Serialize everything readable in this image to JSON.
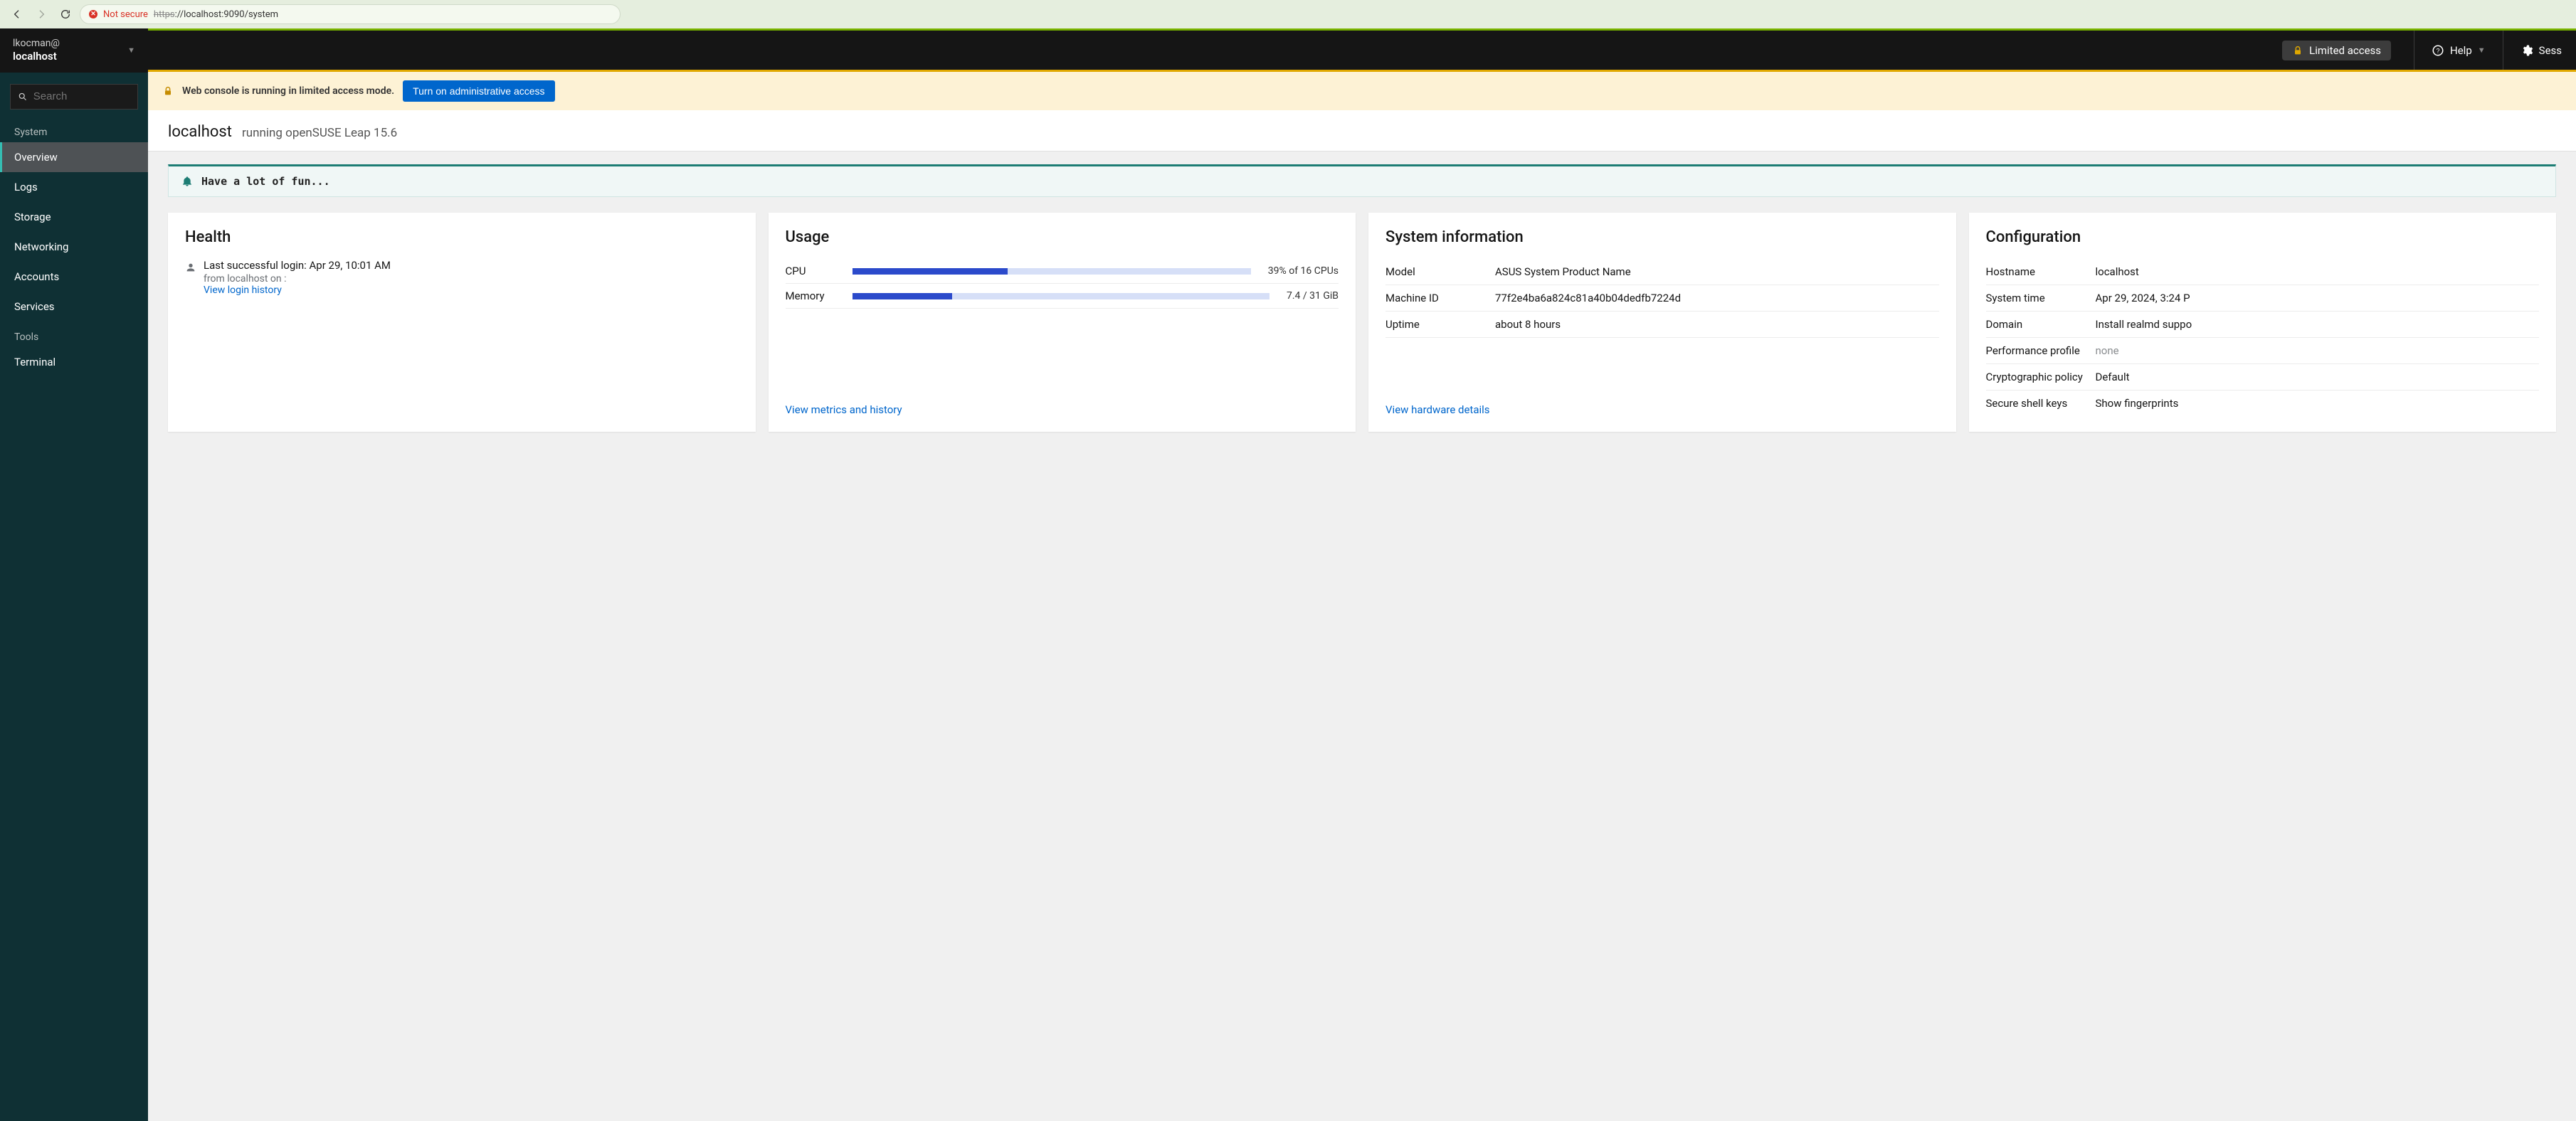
{
  "browser": {
    "not_secure_label": "Not secure",
    "url_scheme": "https",
    "url_rest": "://localhost:9090/system"
  },
  "sidebar": {
    "user": "lkocman@",
    "host": "localhost",
    "search_placeholder": "Search",
    "section_system": "System",
    "items": [
      {
        "label": "Overview"
      },
      {
        "label": "Logs"
      },
      {
        "label": "Storage"
      },
      {
        "label": "Networking"
      },
      {
        "label": "Accounts"
      },
      {
        "label": "Services"
      }
    ],
    "section_tools": "Tools",
    "tools": [
      {
        "label": "Terminal"
      }
    ]
  },
  "topbar": {
    "limited": "Limited access",
    "help": "Help",
    "session": "Sess"
  },
  "alert": {
    "message": "Web console is running in limited access mode.",
    "button": "Turn on administrative access"
  },
  "page": {
    "hostname": "localhost",
    "running": "running openSUSE Leap 15.6"
  },
  "motd": "Have a lot of fun...",
  "health": {
    "title": "Health",
    "last_login": "Last successful login: Apr 29, 10:01 AM",
    "from": "from localhost on :",
    "view_history": "View login history"
  },
  "usage": {
    "title": "Usage",
    "cpu_label": "CPU",
    "cpu_pct": 39,
    "cpu_text": "39% of 16 CPUs",
    "mem_label": "Memory",
    "mem_pct": 24,
    "mem_text": "7.4 / 31 GiB",
    "link": "View metrics and history"
  },
  "sysinfo": {
    "title": "System information",
    "rows": {
      "model_k": "Model",
      "model_v": "ASUS System Product Name",
      "mid_k": "Machine ID",
      "mid_v": "77f2e4ba6a824c81a40b04dedfb7224d",
      "up_k": "Uptime",
      "up_v": "about 8 hours"
    },
    "link": "View hardware details"
  },
  "config": {
    "title": "Configuration",
    "rows": {
      "host_k": "Hostname",
      "host_v": "localhost",
      "time_k": "System time",
      "time_v": "Apr 29, 2024, 3:24 P",
      "dom_k": "Domain",
      "dom_v": "Install realmd suppo",
      "perf_k": "Performance profile",
      "perf_v": "none",
      "cryp_k": "Cryptographic policy",
      "cryp_v": "Default",
      "ssh_k": "Secure shell keys",
      "ssh_v": "Show fingerprints"
    }
  }
}
